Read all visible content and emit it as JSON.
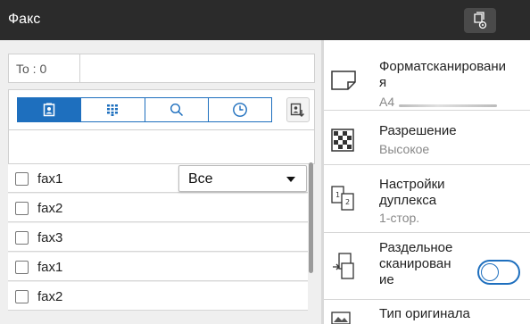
{
  "titlebar": {
    "title": "Факс",
    "action_icon": "fax-settings-icon"
  },
  "destination": {
    "to_label": "To : 0"
  },
  "tabs": [
    {
      "name": "address-book",
      "icon": "address-book-icon",
      "active": true
    },
    {
      "name": "keypad",
      "icon": "keypad-icon",
      "active": false
    },
    {
      "name": "search",
      "icon": "search-icon",
      "active": false
    },
    {
      "name": "history",
      "icon": "clock-icon",
      "active": false
    }
  ],
  "filter": {
    "selected": "Все"
  },
  "list": {
    "items": [
      {
        "label": "fax1"
      },
      {
        "label": "fax2"
      },
      {
        "label": "fax3"
      },
      {
        "label": "fax1"
      },
      {
        "label": "fax2"
      }
    ]
  },
  "settings": {
    "scan_format": {
      "title_line1": "Форматсканировани",
      "title_line2": "я",
      "value": "A4"
    },
    "resolution": {
      "title": "Разрешение",
      "value": "Высокое"
    },
    "duplex": {
      "title_line1": "Настройки",
      "title_line2": "дуплекса",
      "value": "1-стор."
    },
    "separate_scan": {
      "title_line1": "Раздельное",
      "title_line2": "сканирован",
      "title_line3": "ие",
      "enabled": false
    },
    "original_type": {
      "title": "Тип оригинала"
    }
  },
  "colors": {
    "accent": "#1e6fbe",
    "titlebar": "#2b2b2b"
  }
}
